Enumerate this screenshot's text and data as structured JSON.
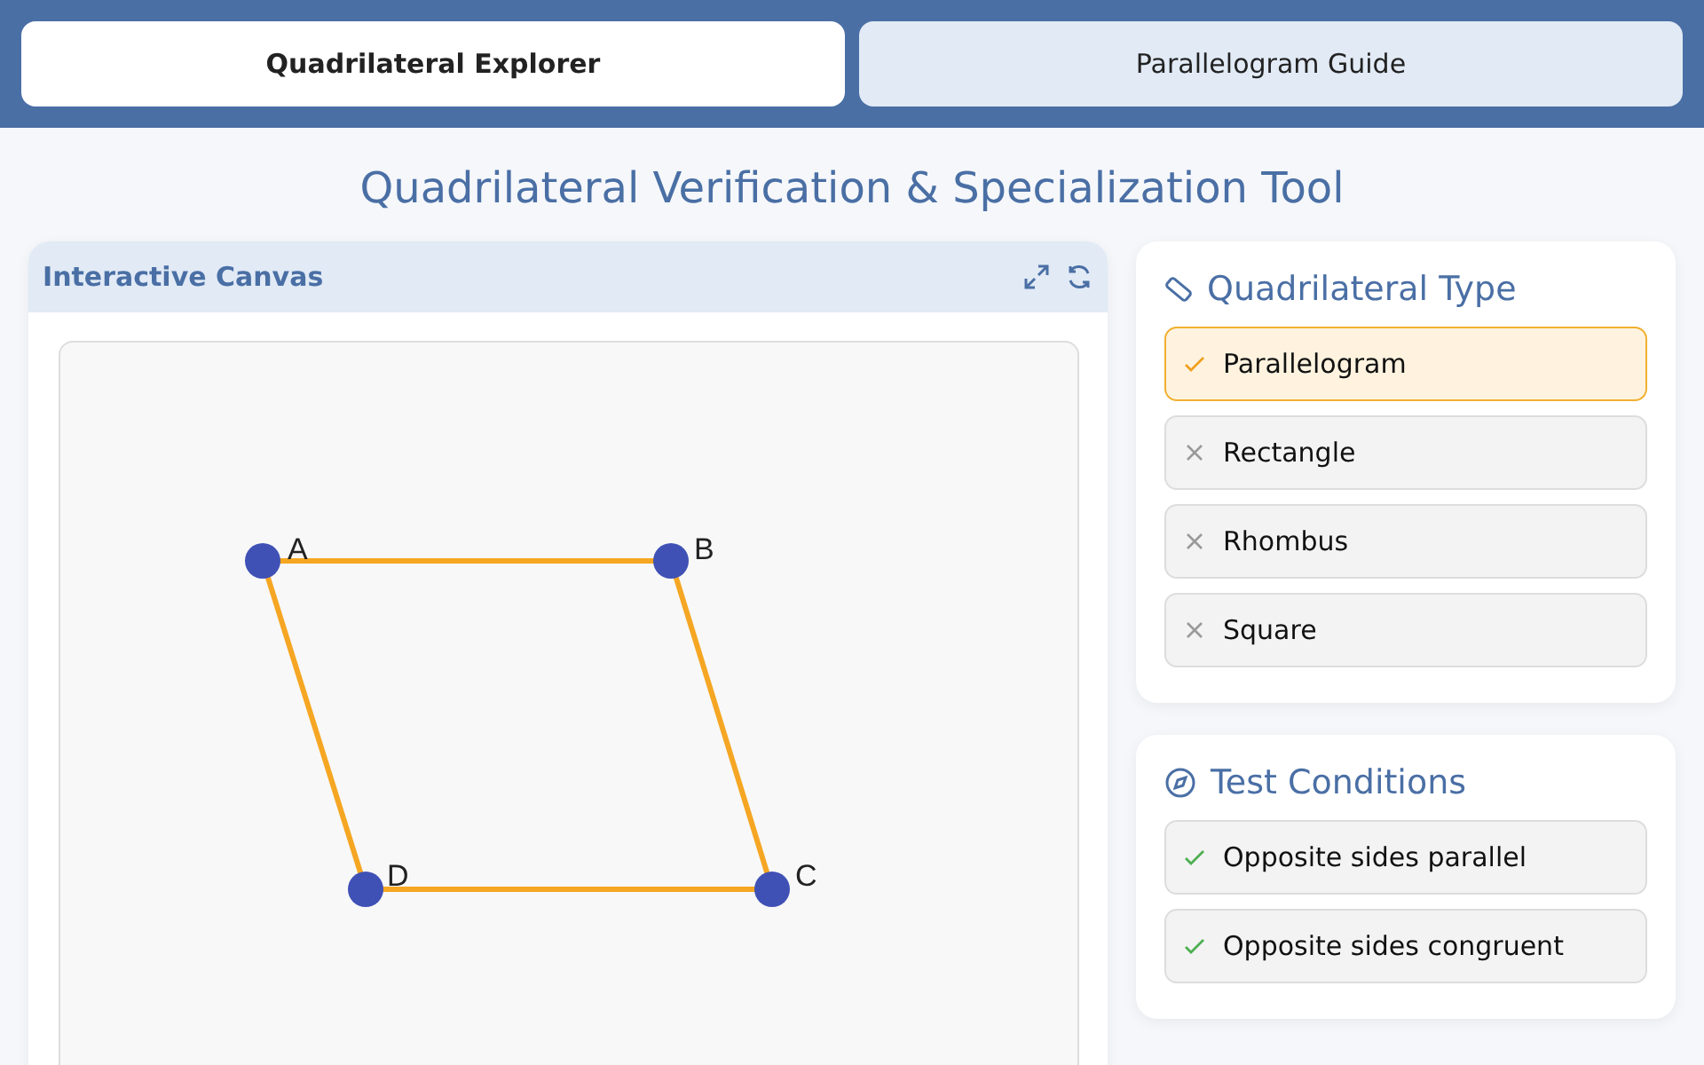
{
  "tabs": [
    {
      "label": "Quadrilateral Explorer",
      "selected": true
    },
    {
      "label": "Parallelogram Guide",
      "selected": false
    }
  ],
  "title": "Quadrilateral Verification & Specialization Tool",
  "canvas_panel": {
    "title": "Interactive Canvas",
    "vertices": [
      "A",
      "B",
      "C",
      "D"
    ]
  },
  "type_card": {
    "title": "Quadrilateral Type",
    "types": [
      {
        "label": "Parallelogram",
        "selected": true
      },
      {
        "label": "Rectangle",
        "selected": false
      },
      {
        "label": "Rhombus",
        "selected": false
      },
      {
        "label": "Square",
        "selected": false
      }
    ]
  },
  "conditions_card": {
    "title": "Test Conditions",
    "conditions": [
      {
        "label": "Opposite sides parallel",
        "met": true
      },
      {
        "label": "Opposite sides congruent",
        "met": true
      }
    ]
  }
}
